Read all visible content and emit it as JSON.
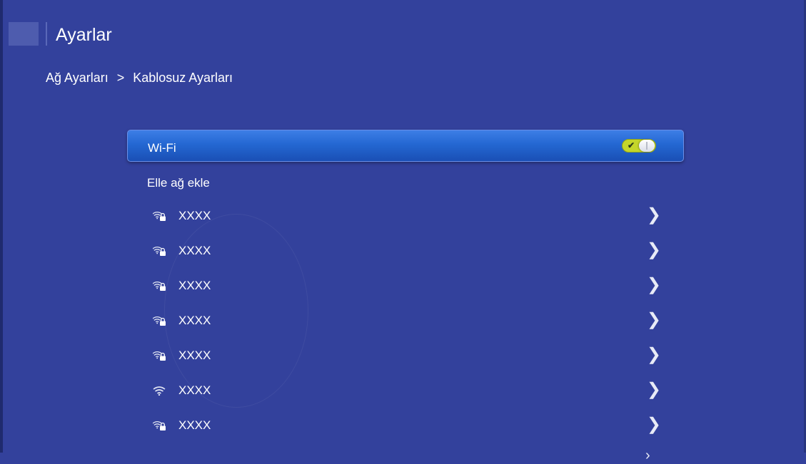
{
  "header": {
    "title": "Ayarlar"
  },
  "breadcrumb": {
    "parent": "Ağ Ayarları",
    "separator": ">",
    "current": "Kablosuz Ayarları"
  },
  "wifi": {
    "label": "Wi-Fi",
    "toggle_state": "on",
    "toggle_check": "✔"
  },
  "manual_add": {
    "label": "Elle ağ ekle"
  },
  "networks": [
    {
      "name": "XXXX",
      "icon": "wifi-lock-icon",
      "chevron": "❯"
    },
    {
      "name": "XXXX",
      "icon": "wifi-lock-icon",
      "chevron": "❯"
    },
    {
      "name": "XXXX",
      "icon": "wifi-lock-icon",
      "chevron": "❯"
    },
    {
      "name": "XXXX",
      "icon": "wifi-lock-icon",
      "chevron": "❯"
    },
    {
      "name": "XXXX",
      "icon": "wifi-lock-icon",
      "chevron": "❯"
    },
    {
      "name": "XXXX",
      "icon": "wifi-icon",
      "chevron": "❯"
    },
    {
      "name": "XXXX",
      "icon": "wifi-lock-icon",
      "chevron": "❯"
    }
  ],
  "colors": {
    "background": "#33419c",
    "selected_row": "#2467d2",
    "toggle_on": "#c4d62a"
  }
}
